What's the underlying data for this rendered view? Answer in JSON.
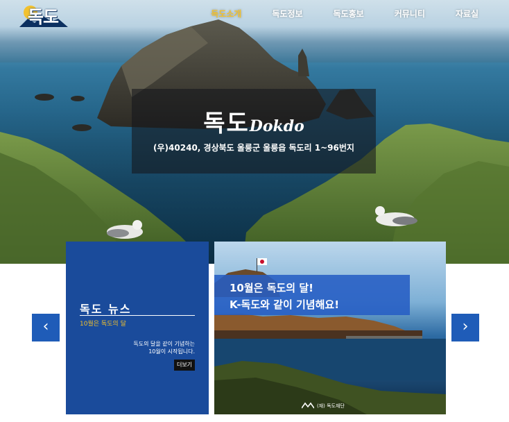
{
  "nav": {
    "logo_text": "독도",
    "items": [
      {
        "label": "독도소개",
        "active": true
      },
      {
        "label": "독도정보",
        "active": false
      },
      {
        "label": "독도홍보",
        "active": false
      },
      {
        "label": "커뮤니티",
        "active": false
      },
      {
        "label": "자료실",
        "active": false
      }
    ]
  },
  "hero": {
    "title_ko": "독도",
    "title_en": "Dokdo",
    "address": "(우)40240, 경상북도 울릉군 울릉읍 독도리 1~96번지"
  },
  "news": {
    "heading": "독도 뉴스",
    "subtitle": "10월은 독도의 달",
    "description_line1": "독도의 달을 같이 기념하는",
    "description_line2": "10월이 시작됩니다.",
    "more_label": "더보기"
  },
  "banner": {
    "line1": "10월은 독도의 달!",
    "line2": "K-독도와 같이 기념해요!",
    "footer": "(재) 독도재단"
  },
  "arrows": {
    "prev": "‹",
    "next": "›"
  },
  "colors": {
    "accent": "#1f5cb8",
    "news_bg": "#1a4b9b",
    "highlight": "#f2c12e"
  },
  "icons": [
    "logo-mark",
    "chevron-left-icon",
    "chevron-right-icon",
    "foundation-logo"
  ]
}
